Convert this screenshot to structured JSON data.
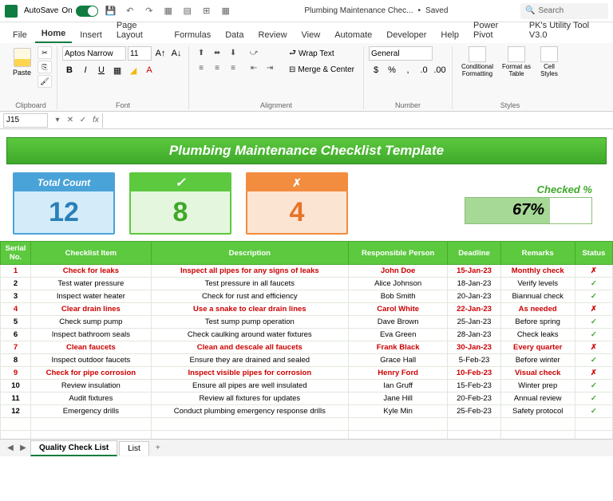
{
  "titlebar": {
    "autosave_label": "AutoSave",
    "autosave_state": "On",
    "doc_name": "Plumbing Maintenance Chec...",
    "saved_status": "Saved",
    "search_placeholder": "Search"
  },
  "menu": {
    "file": "File",
    "home": "Home",
    "insert": "Insert",
    "page_layout": "Page Layout",
    "formulas": "Formulas",
    "data": "Data",
    "review": "Review",
    "view": "View",
    "automate": "Automate",
    "developer": "Developer",
    "help": "Help",
    "power_pivot": "Power Pivot",
    "pk_tool": "PK's Utility Tool V3.0"
  },
  "ribbon": {
    "clipboard": {
      "label": "Clipboard",
      "paste": "Paste"
    },
    "font": {
      "label": "Font",
      "name": "Aptos Narrow",
      "size": "11"
    },
    "alignment": {
      "label": "Alignment",
      "wrap": "Wrap Text",
      "merge": "Merge & Center"
    },
    "number": {
      "label": "Number",
      "format": "General"
    },
    "styles": {
      "label": "Styles",
      "conditional": "Conditional Formatting",
      "table": "Format as Table",
      "cell": "Cell Styles"
    }
  },
  "formula_bar": {
    "cell_ref": "J15",
    "fx": "fx"
  },
  "banner": "Plumbing Maintenance Checklist Template",
  "cards": {
    "total": {
      "label": "Total Count",
      "value": "12"
    },
    "ok": {
      "label": "✓",
      "value": "8"
    },
    "no": {
      "label": "✗",
      "value": "4"
    },
    "checked": {
      "label": "Checked %",
      "value": "67%",
      "pct": 67
    }
  },
  "table": {
    "headers": [
      "Serial No.",
      "Checklist Item",
      "Description",
      "Responsible Person",
      "Deadline",
      "Remarks",
      "Status"
    ],
    "rows": [
      {
        "n": "1",
        "item": "Check for leaks",
        "desc": "Inspect all pipes for any signs of leaks",
        "person": "John Doe",
        "deadline": "15-Jan-23",
        "remarks": "Monthly check",
        "status": "✗",
        "red": true
      },
      {
        "n": "2",
        "item": "Test water pressure",
        "desc": "Test pressure in all faucets",
        "person": "Alice Johnson",
        "deadline": "18-Jan-23",
        "remarks": "Verify levels",
        "status": "✓",
        "red": false
      },
      {
        "n": "3",
        "item": "Inspect water heater",
        "desc": "Check for rust and efficiency",
        "person": "Bob Smith",
        "deadline": "20-Jan-23",
        "remarks": "Biannual check",
        "status": "✓",
        "red": false
      },
      {
        "n": "4",
        "item": "Clear drain lines",
        "desc": "Use a snake to clear drain lines",
        "person": "Carol White",
        "deadline": "22-Jan-23",
        "remarks": "As needed",
        "status": "✗",
        "red": true
      },
      {
        "n": "5",
        "item": "Check sump pump",
        "desc": "Test sump pump operation",
        "person": "Dave Brown",
        "deadline": "25-Jan-23",
        "remarks": "Before spring",
        "status": "✓",
        "red": false
      },
      {
        "n": "6",
        "item": "Inspect bathroom seals",
        "desc": "Check caulking around water fixtures",
        "person": "Eva Green",
        "deadline": "28-Jan-23",
        "remarks": "Check leaks",
        "status": "✓",
        "red": false
      },
      {
        "n": "7",
        "item": "Clean faucets",
        "desc": "Clean and descale all faucets",
        "person": "Frank Black",
        "deadline": "30-Jan-23",
        "remarks": "Every quarter",
        "status": "✗",
        "red": true
      },
      {
        "n": "8",
        "item": "Inspect outdoor faucets",
        "desc": "Ensure they are drained and sealed",
        "person": "Grace Hall",
        "deadline": "5-Feb-23",
        "remarks": "Before winter",
        "status": "✓",
        "red": false
      },
      {
        "n": "9",
        "item": "Check for pipe corrosion",
        "desc": "Inspect visible pipes for corrosion",
        "person": "Henry Ford",
        "deadline": "10-Feb-23",
        "remarks": "Visual check",
        "status": "✗",
        "red": true
      },
      {
        "n": "10",
        "item": "Review insulation",
        "desc": "Ensure all pipes are well insulated",
        "person": "Ian Gruff",
        "deadline": "15-Feb-23",
        "remarks": "Winter prep",
        "status": "✓",
        "red": false
      },
      {
        "n": "11",
        "item": "Audit fixtures",
        "desc": "Review all fixtures for updates",
        "person": "Jane Hill",
        "deadline": "20-Feb-23",
        "remarks": "Annual review",
        "status": "✓",
        "red": false
      },
      {
        "n": "12",
        "item": "Emergency drills",
        "desc": "Conduct plumbing emergency response drills",
        "person": "Kyle Min",
        "deadline": "25-Feb-23",
        "remarks": "Safety protocol",
        "status": "✓",
        "red": false
      }
    ]
  },
  "sheets": {
    "active": "Quality Check List",
    "other": "List"
  }
}
